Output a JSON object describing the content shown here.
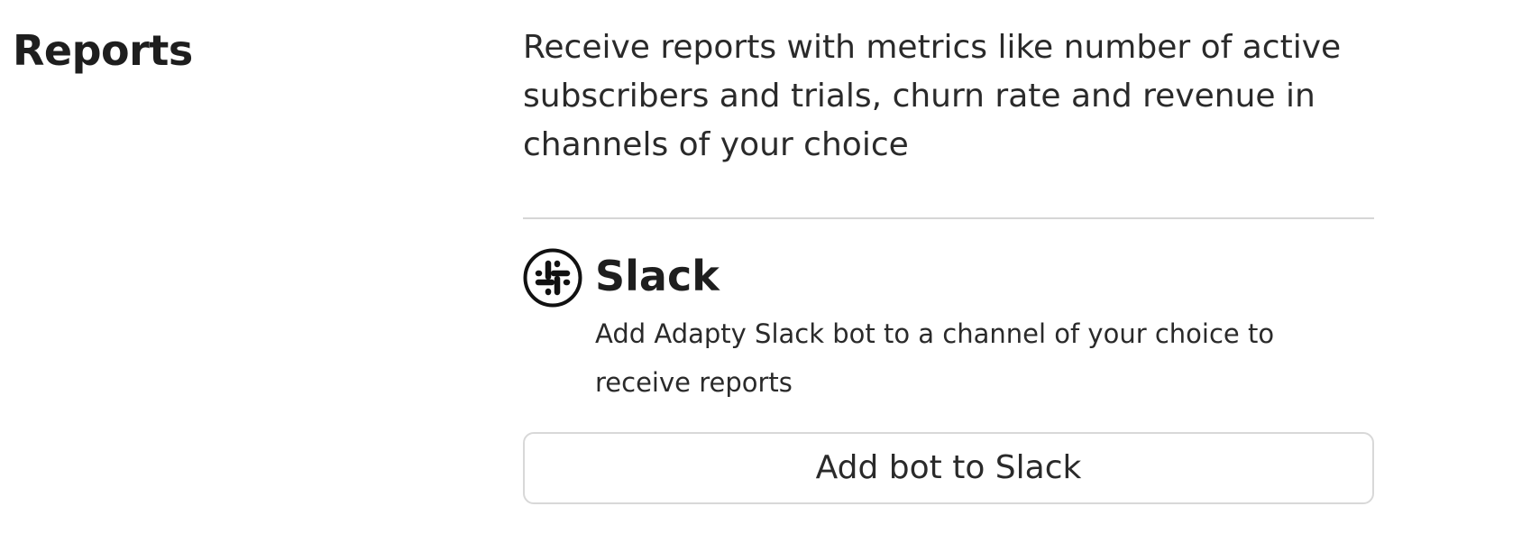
{
  "section": {
    "title": "Reports",
    "description": "Receive reports with metrics like number of active subscribers and trials, churn rate and revenue in channels of your choice"
  },
  "integration": {
    "name": "Slack",
    "icon": "slack-icon",
    "description": "Add Adapty Slack bot to a channel of your choice to receive reports",
    "button_label": "Add bot to Slack"
  },
  "colors": {
    "text": "#222222",
    "divider": "#d6d6d6",
    "button_border": "#d8d8d8"
  }
}
